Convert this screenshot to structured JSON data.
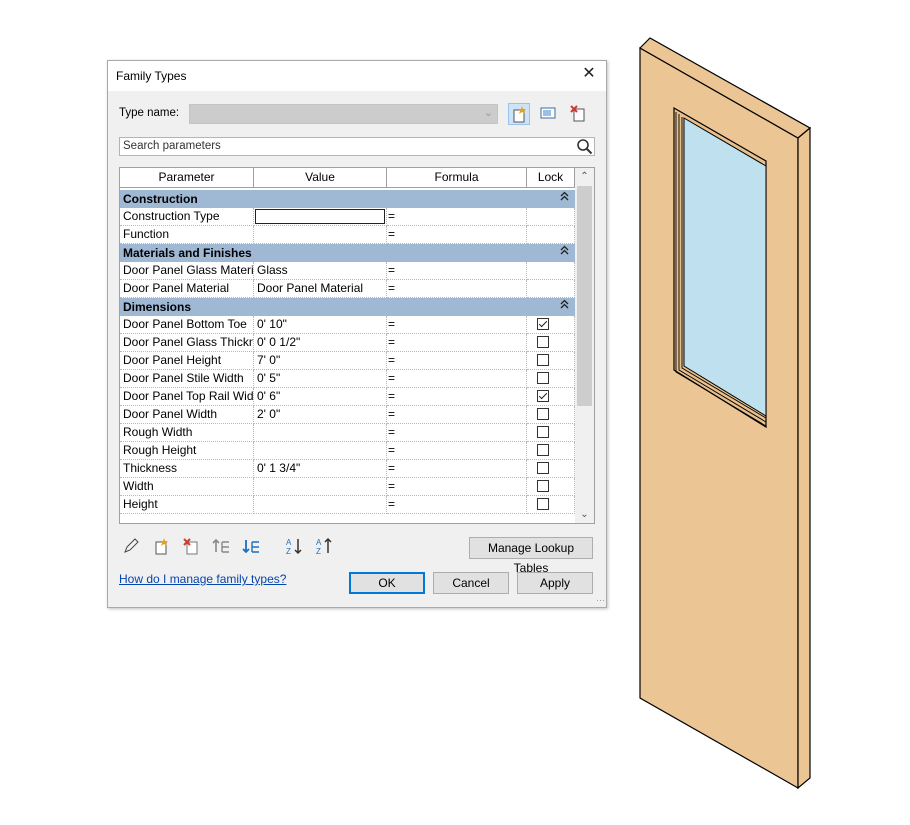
{
  "dialog": {
    "title": "Family Types",
    "type_name_label": "Type name:",
    "type_name_value": "",
    "search_placeholder": "Search parameters",
    "link_text": "How do I manage family types?",
    "buttons": {
      "manage_lookup": "Manage Lookup Tables",
      "ok": "OK",
      "cancel": "Cancel",
      "apply": "Apply"
    },
    "columns": [
      "Parameter",
      "Value",
      "Formula",
      "Lock"
    ],
    "groups": [
      {
        "name": "Construction",
        "rows": [
          {
            "param": "Construction Type",
            "value": "",
            "formula": "=",
            "lock": null,
            "editing": true
          },
          {
            "param": "Function",
            "value": "",
            "formula": "=",
            "lock": null
          }
        ]
      },
      {
        "name": "Materials and Finishes",
        "rows": [
          {
            "param": "Door Panel Glass Materi",
            "value": "Glass",
            "formula": "=",
            "lock": null
          },
          {
            "param": "Door Panel Material",
            "value": "Door Panel Material",
            "formula": "=",
            "lock": null
          }
        ]
      },
      {
        "name": "Dimensions",
        "rows": [
          {
            "param": "Door Panel Bottom Toe",
            "value": "0'  10\"",
            "formula": "=",
            "lock": true
          },
          {
            "param": "Door Panel Glass Thickn",
            "value": "0'  0 1/2\"",
            "formula": "=",
            "lock": false
          },
          {
            "param": "Door Panel Height",
            "value": "7'  0\"",
            "formula": "=",
            "lock": false
          },
          {
            "param": "Door Panel Stile Width",
            "value": "0'  5\"",
            "formula": "=",
            "lock": false
          },
          {
            "param": "Door Panel Top Rail Wid",
            "value": "0'  6\"",
            "formula": "=",
            "lock": true
          },
          {
            "param": "Door Panel Width",
            "value": "2'  0\"",
            "formula": "=",
            "lock": false
          },
          {
            "param": "Rough Width",
            "value": "",
            "formula": "=",
            "lock": false
          },
          {
            "param": "Rough Height",
            "value": "",
            "formula": "=",
            "lock": false
          },
          {
            "param": "Thickness",
            "value": "0'  1 3/4\"",
            "formula": "=",
            "lock": false
          },
          {
            "param": "Width",
            "value": "",
            "formula": "=",
            "lock": false
          },
          {
            "param": "Height",
            "value": "",
            "formula": "=",
            "lock": false
          }
        ]
      }
    ],
    "toolbar_icons": [
      "new-type-icon",
      "rename-type-icon",
      "delete-type-icon"
    ],
    "bottom_icons": [
      "edit-parameter-icon",
      "new-parameter-icon",
      "delete-parameter-icon",
      "move-up-icon",
      "move-down-icon",
      "sort-ascending-icon",
      "sort-descending-icon"
    ]
  },
  "colors": {
    "group_header": "#9fb8d4",
    "door_wood": "#ebc594",
    "glass": "#bfe0ee",
    "accent": "#0078d7"
  }
}
